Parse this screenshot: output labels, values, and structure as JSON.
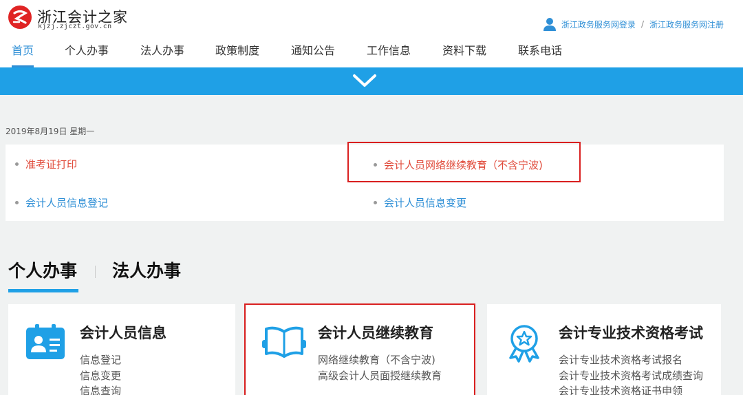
{
  "header": {
    "site_name": "浙江会计之家",
    "site_url": "kjzj.zjczt.gov.cn",
    "login_link": "浙江政务服务网登录",
    "separator": "/",
    "register_link": "浙江政务服务网注册"
  },
  "nav": {
    "items": [
      "首页",
      "个人办事",
      "法人办事",
      "政策制度",
      "通知公告",
      "工作信息",
      "资料下载",
      "联系电话"
    ],
    "active_index": 0
  },
  "date": "2019年8月19日 星期一",
  "quick_links": [
    {
      "label": "准考证打印",
      "color": "red"
    },
    {
      "label": "会计人员网络继续教育（不含宁波)",
      "color": "red",
      "highlighted": true
    },
    {
      "label": "会计人员信息登记",
      "color": "blue"
    },
    {
      "label": "会计人员信息变更",
      "color": "blue"
    }
  ],
  "tabs": [
    "个人办事",
    "法人办事"
  ],
  "cards": [
    {
      "icon": "id-card-icon",
      "title": "会计人员信息",
      "items": [
        "信息登记",
        "信息变更",
        "信息查询"
      ]
    },
    {
      "icon": "open-book-icon",
      "title": "会计人员继续教育",
      "items": [
        "网络继续教育（不含宁波)",
        "高级会计人员面授继续教育"
      ],
      "highlighted": true
    },
    {
      "icon": "award-badge-icon",
      "title": "会计专业技术资格考试",
      "items": [
        "会计专业技术资格考试报名",
        "会计专业技术资格考试成绩查询",
        "会计专业技术资格证书申领"
      ]
    }
  ],
  "colors": {
    "accent_blue": "#1fa0e6",
    "link_blue": "#2f8fd6",
    "link_red": "#e04a3a",
    "highlight_box": "#d91f1f"
  }
}
